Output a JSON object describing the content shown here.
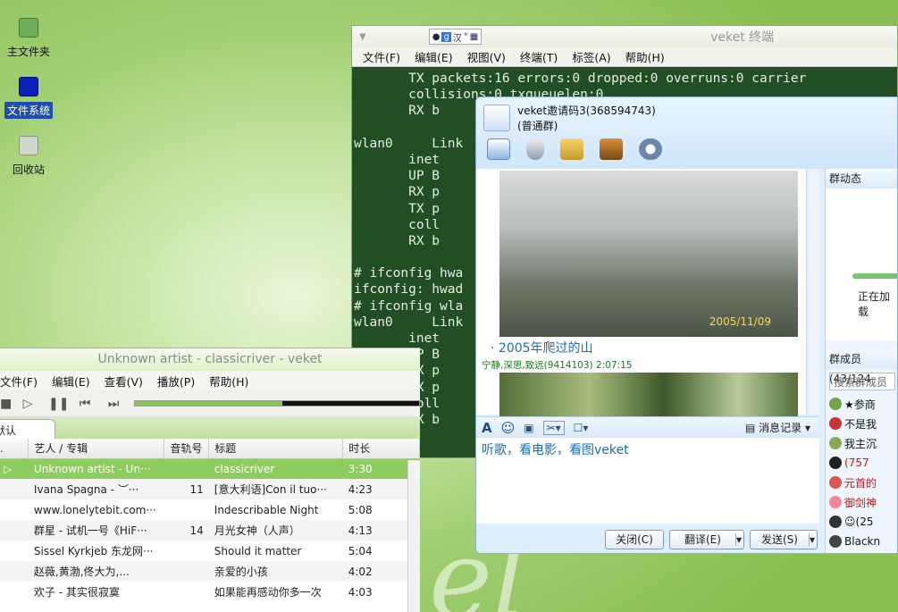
{
  "desktop": {
    "icons": [
      {
        "label": "主文件夹",
        "color": "#6fae5a"
      },
      {
        "label": "文件系统",
        "color": "#0a1fb8",
        "selected": true
      },
      {
        "label": "回收站",
        "color": "#cfd6cc"
      }
    ]
  },
  "terminal": {
    "title": "veket 终端",
    "ime": [
      "g",
      "汉",
      "°"
    ],
    "menu": [
      "文件(F)",
      "编辑(E)",
      "视图(V)",
      "终端(T)",
      "标签(A)",
      "帮助(H)"
    ],
    "lines": [
      "       TX packets:16 errors:0 dropped:0 overruns:0 carrier",
      "       collisions:0 txqueuelen:0",
      "       RX b",
      "",
      "wlan0     Link",
      "       inet",
      "       UP B",
      "       RX p",
      "       TX p",
      "       coll",
      "       RX b",
      "",
      "# ifconfig hwa",
      "ifconfig: hwad",
      "# ifconfig wla",
      "wlan0     Link",
      "       inet",
      "       UP B",
      "       RX p",
      "       TX p",
      "       coll",
      "       RX b",
      "",
      "# "
    ]
  },
  "music": {
    "title": "Unknown artist - classicriver - veket",
    "menu": [
      "文件(F)",
      "编辑(E)",
      "查看(V)",
      "播放(P)",
      "帮助(H)"
    ],
    "progress": 0.52,
    "tab": "默认",
    "columns": [
      ". ",
      "艺人 / 专辑",
      "音轨号",
      "标题",
      "时长"
    ],
    "rows": [
      {
        "artist": "Unknown artist - Un···",
        "track": "",
        "title": "classicriver",
        "time": "3:30"
      },
      {
        "artist": "Ivana Spagna - ︶···",
        "track": "11",
        "title": "[意大利语]Con il tuo···",
        "time": "4:23"
      },
      {
        "artist": "www.lonelytebit.com···",
        "track": "",
        "title": "Indescribable Night",
        "time": "5:08"
      },
      {
        "artist": "群星 - 试机一号《HiF···",
        "track": "14",
        "title": "月光女神（人声）",
        "time": "4:13"
      },
      {
        "artist": "Sissel Kyrkjeb 东龙网···",
        "track": "",
        "title": "Should it matter",
        "time": "5:04"
      },
      {
        "artist": "赵薇,黄渤,佟大为,...",
        "track": "",
        "title": "亲爱的小孩",
        "time": "4:02"
      },
      {
        "artist": "欢子 - 其实很寂寞",
        "track": "",
        "title": "如果能再感动你多一次",
        "time": "4:03"
      }
    ]
  },
  "qq": {
    "group_name": "veket邀请码3(368594743)",
    "group_type": "(普通群)",
    "photo_date": "2005/11/09",
    "caption": "2005年爬过的山",
    "sender": "宁静,深思,致远(9414103)  2:07:15",
    "input_text": "听歌，看电影，看图veket",
    "history_label": "消息记录",
    "buttons": {
      "close": "关闭(C)",
      "translate": "翻译(E)",
      "send": "发送(S)"
    },
    "side": {
      "dynamics": "群动态",
      "loading": "正在加载",
      "members_title": "群成员(43/124",
      "search_placeholder": "搜索群成员",
      "members": [
        {
          "name": "★参商",
          "color": "#111"
        },
        {
          "name": "不是我",
          "color": "#111"
        },
        {
          "name": "我主沉",
          "color": "#111"
        },
        {
          "name": "(757",
          "color": "#d01010"
        },
        {
          "name": "元首的",
          "color": "#d01010"
        },
        {
          "name": "御剑神",
          "color": "#d01010"
        },
        {
          "name": "☺(25",
          "color": "#111"
        },
        {
          "name": "Blackn",
          "color": "#111"
        }
      ]
    }
  }
}
